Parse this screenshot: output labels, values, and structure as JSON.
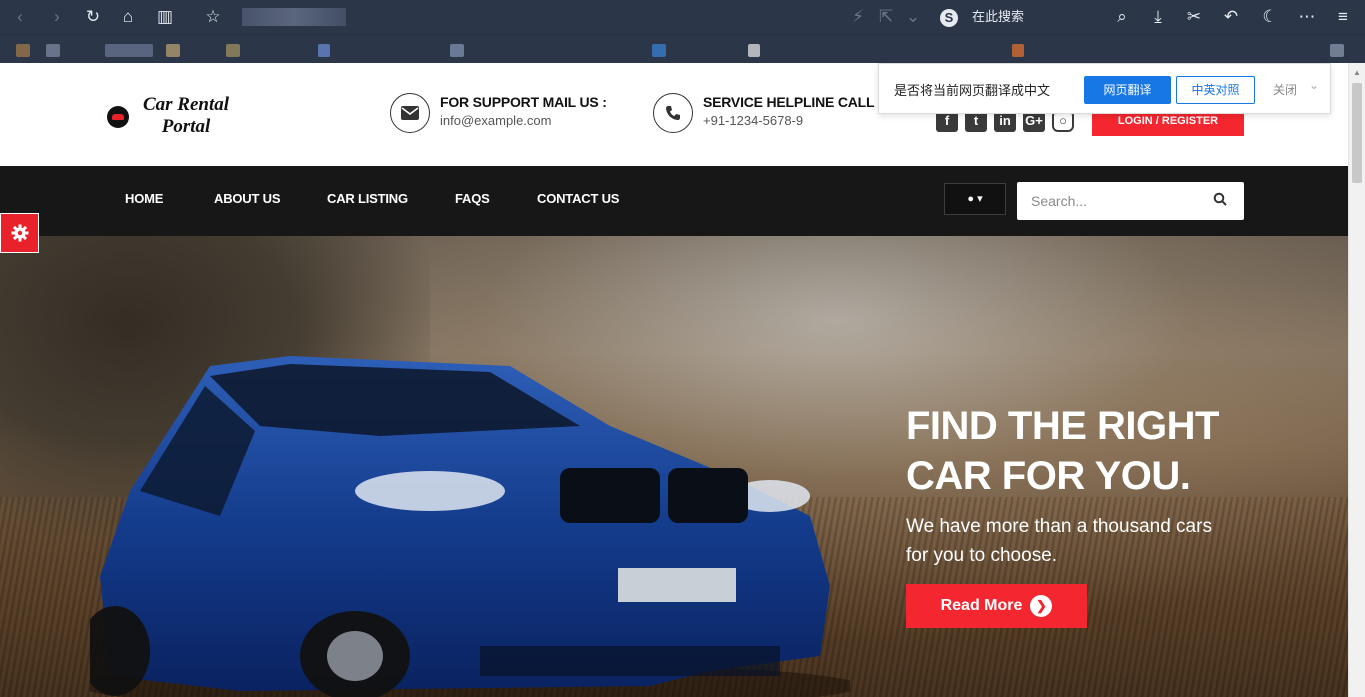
{
  "browser": {
    "search_placeholder": "在此搜索",
    "icons": [
      "back-icon",
      "forward-icon",
      "refresh-icon",
      "home-icon",
      "reader-icon",
      "star-icon",
      "lightning-icon",
      "share-icon",
      "chevron-down-icon",
      "sogou-icon",
      "search-icon",
      "download-icon",
      "scissors-icon",
      "undo-icon",
      "moon-icon",
      "more-icon",
      "menu-icon"
    ]
  },
  "translate_bar": {
    "prompt": "是否将当前网页翻译成中文",
    "translate_label": "网页翻译",
    "bilingual_label": "中英对照",
    "close_label": "关闭",
    "accent": "#1677e5"
  },
  "site": {
    "logo": {
      "line1": "Car Rental",
      "line2": "Portal"
    },
    "support": {
      "title": "FOR SUPPORT MAIL US :",
      "value": "info@example.com"
    },
    "helpline": {
      "title": "SERVICE HELPLINE CALL",
      "value": "+91-1234-5678-9"
    },
    "social": [
      "facebook-icon",
      "twitter-icon",
      "linkedin-icon",
      "google-plus-icon",
      "instagram-icon"
    ],
    "login_label": "LOGIN / REGISTER",
    "accent": "#f4262f"
  },
  "nav": {
    "items": [
      "HOME",
      "ABOUT US",
      "CAR LISTING",
      "FAQS",
      "CONTACT US"
    ],
    "user_caret": "▾",
    "search_placeholder": "Search..."
  },
  "hero": {
    "title_line1": "FIND THE RIGHT",
    "title_line2": "CAR FOR YOU.",
    "subtitle": "We have more than a thousand cars for you to choose.",
    "button_label": "Read More"
  }
}
